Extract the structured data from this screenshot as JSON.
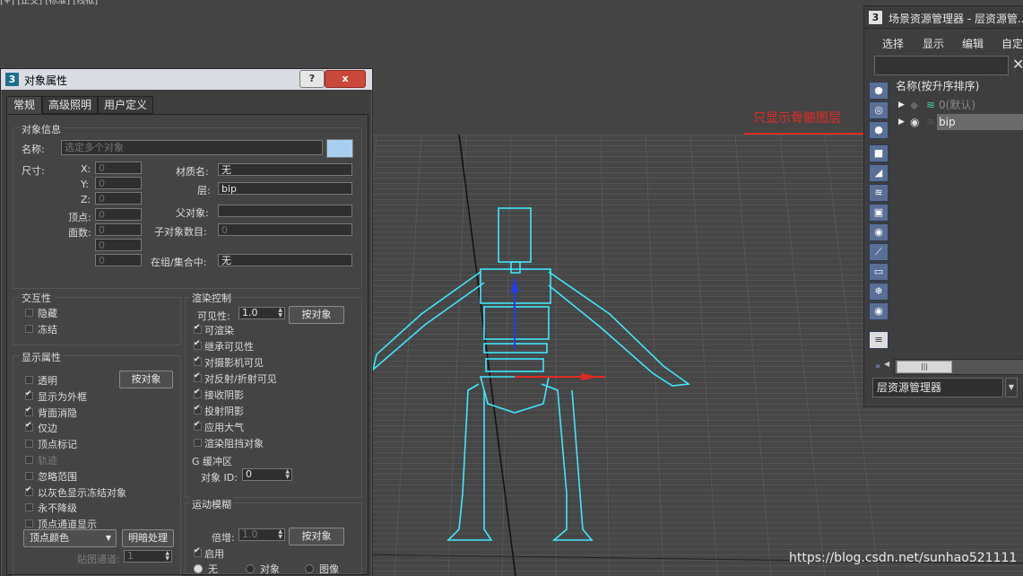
{
  "viewport": {
    "top_text": "[+] [正交] [标准] [线框]"
  },
  "dialog": {
    "title": "对象属性",
    "app_badge": "3",
    "help_label": "?",
    "close_label": "x",
    "tabs": [
      "常规",
      "高级照明",
      "用户定义"
    ],
    "info": {
      "group_title": "对象信息",
      "name_label": "名称:",
      "name_placeholder": "选定多个对象",
      "dims_label": "尺寸:",
      "x_label": "X:",
      "x_value": "0",
      "y_label": "Y:",
      "y_value": "0",
      "z_label": "Z:",
      "z_value": "0",
      "verts_label": "顶点:",
      "verts_value": "0",
      "faces_label": "面数:",
      "faces_value": "0",
      "extra1": "0",
      "extra2": "0",
      "material_label": "材质名:",
      "material_value": "无",
      "layer_label": "层:",
      "layer_value": "bip",
      "parent_label": "父对象:",
      "parent_value": "",
      "children_label": "子对象数目:",
      "children_value": "0",
      "ingroup_label": "在组/集合中:",
      "ingroup_value": "无"
    },
    "interactivity": {
      "group_title": "交互性",
      "hide": "隐藏",
      "freeze": "冻结"
    },
    "display": {
      "group_title": "显示属性",
      "by_object": "按对象",
      "items": [
        {
          "label": "透明",
          "checked": false,
          "dim": false
        },
        {
          "label": "显示为外框",
          "checked": true,
          "dim": false
        },
        {
          "label": "背面消隐",
          "checked": true,
          "dim": false
        },
        {
          "label": "仅边",
          "checked": true,
          "dim": false
        },
        {
          "label": "顶点标记",
          "checked": false,
          "dim": false
        },
        {
          "label": "轨迹",
          "checked": false,
          "dim": true
        },
        {
          "label": "忽略范围",
          "checked": false,
          "dim": false
        },
        {
          "label": "以灰色显示冻结对象",
          "checked": true,
          "dim": false
        },
        {
          "label": "永不降级",
          "checked": false,
          "dim": false
        },
        {
          "label": "顶点通道显示",
          "checked": false,
          "dim": false
        }
      ],
      "vertex_color": "顶点颜色",
      "shaded": "明暗处理",
      "map_channel_label": "贴图通道:",
      "map_channel_value": "1"
    },
    "render": {
      "group_title": "渲染控制",
      "visibility_label": "可见性:",
      "visibility_value": "1.0",
      "by_object": "按对象",
      "items": [
        {
          "label": "可渲染",
          "checked": true
        },
        {
          "label": "继承可见性",
          "checked": true
        },
        {
          "label": "对摄影机可见",
          "checked": true
        },
        {
          "label": "对反射/折射可见",
          "checked": true
        },
        {
          "label": "接收阴影",
          "checked": true
        },
        {
          "label": "投射阴影",
          "checked": true
        },
        {
          "label": "应用大气",
          "checked": true
        },
        {
          "label": "渲染阻挡对象",
          "checked": false
        }
      ]
    },
    "gbuffer": {
      "group_title": "G 缓冲区",
      "object_id_label": "对象 ID:",
      "object_id_value": "0"
    },
    "motion_blur": {
      "group_title": "运动模糊",
      "multiplier_label": "倍增:",
      "multiplier_value": "1.0",
      "by_object": "按对象",
      "enabled_label": "启用",
      "radio_none": "无",
      "radio_object": "对象",
      "radio_image": "图像"
    }
  },
  "scene_explorer": {
    "title": "场景资源管理器 - 层资源管...",
    "app_badge": "3",
    "menu": [
      "选择",
      "显示",
      "编辑",
      "自定"
    ],
    "column_header": "名称(按升序排序)",
    "rows": [
      {
        "name": "0(默认)",
        "selected": false
      },
      {
        "name": "bip",
        "selected": true
      }
    ],
    "scroll_thumb": "|||",
    "bottom_select": "层资源管理器"
  },
  "annotation": "只显示骨骼图层",
  "watermark": "https://blog.csdn.net/sunhao521111",
  "colors": {
    "wire": "#3fe6ff",
    "accent": "#e32b22",
    "panel": "#444444"
  }
}
